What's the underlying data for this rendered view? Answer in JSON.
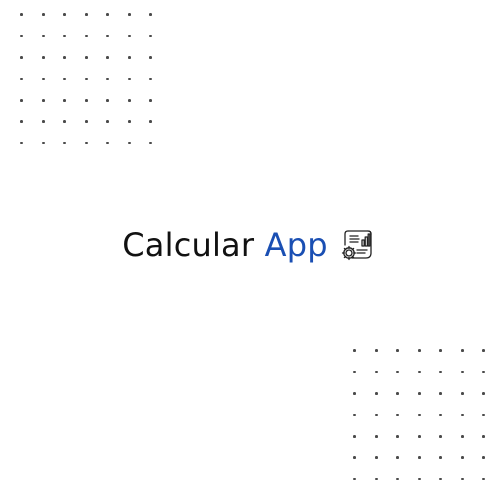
{
  "app": {
    "title_main": "Calcular",
    "title_accent": "App",
    "accent_color": "#1a4fb3",
    "text_color": "#111111",
    "logo_icon": "calculator-report-gear-icon"
  },
  "decor": {
    "dot_color": "#4a4a4a"
  }
}
